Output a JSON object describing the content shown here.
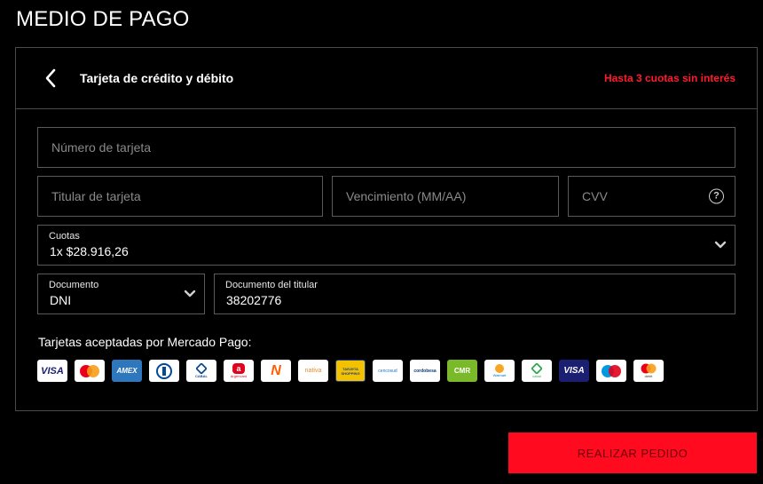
{
  "page": {
    "title": "MEDIO DE PAGO"
  },
  "payment_method": {
    "back_icon": "chevron-left-icon",
    "title": "Tarjeta de crédito y débito",
    "promo": "Hasta 3 cuotas sin interés"
  },
  "form": {
    "card_number": {
      "placeholder": "Número de tarjeta",
      "value": ""
    },
    "card_holder": {
      "placeholder": "Titular de tarjeta",
      "value": ""
    },
    "expiry": {
      "placeholder": "Vencimiento (MM/AA)",
      "value": ""
    },
    "cvv": {
      "placeholder": "CVV",
      "value": "",
      "help_icon": "question-circle-icon",
      "help_glyph": "?"
    },
    "installments": {
      "label": "Cuotas",
      "value": "1x $28.916,26"
    },
    "document_type": {
      "label": "Documento",
      "value": "DNI"
    },
    "document_number": {
      "label": "Documento del titular",
      "value": "38202776"
    }
  },
  "accepted_cards": {
    "label": "Tarjetas aceptadas por Mercado Pago:",
    "cards": [
      {
        "name": "Visa",
        "text": "VISA",
        "color": "#1a1f71"
      },
      {
        "name": "Mastercard",
        "text": "",
        "color": "#eb001b"
      },
      {
        "name": "American Express",
        "text": "AMEX",
        "color": "#2e77bc"
      },
      {
        "name": "Diners",
        "text": "",
        "color": "#004a97"
      },
      {
        "name": "Cabal",
        "text": "CABAL",
        "color": "#0e4c92"
      },
      {
        "name": "Argencard",
        "text": "Argencard",
        "color": "#e2001a"
      },
      {
        "name": "Naranja",
        "text": "N",
        "color": "#ff5f00"
      },
      {
        "name": "Nativa",
        "text": "nativa",
        "color": "#e88a2a"
      },
      {
        "name": "Tarjeta Shopping",
        "text": "TARJETA SHOPPING",
        "color": "#1f3f8a"
      },
      {
        "name": "Cencosud",
        "text": "cencosud",
        "color": "#1d73c7"
      },
      {
        "name": "Cordobesa",
        "text": "cordobesa",
        "color": "#0a3a78"
      },
      {
        "name": "CMR Falabella",
        "text": "CMR",
        "color": "#7ab929"
      },
      {
        "name": "Tarjeta Walmart",
        "text": "Walmart",
        "color": "#0071ce"
      },
      {
        "name": "Cabal Debito",
        "text": "cabal",
        "color": "#2fa84f"
      },
      {
        "name": "Visa Debito",
        "text": "VISA",
        "color": "#1a1f71"
      },
      {
        "name": "Maestro",
        "text": "",
        "color": "#0099df"
      },
      {
        "name": "Mastercard Debito",
        "text": "debit",
        "color": "#eb001b"
      }
    ]
  },
  "submit": {
    "label": "REALIZAR PEDIDO"
  },
  "colors": {
    "accent": "#ff0a1e",
    "promo": "#ff1a2e",
    "border": "#4a4a4a"
  }
}
